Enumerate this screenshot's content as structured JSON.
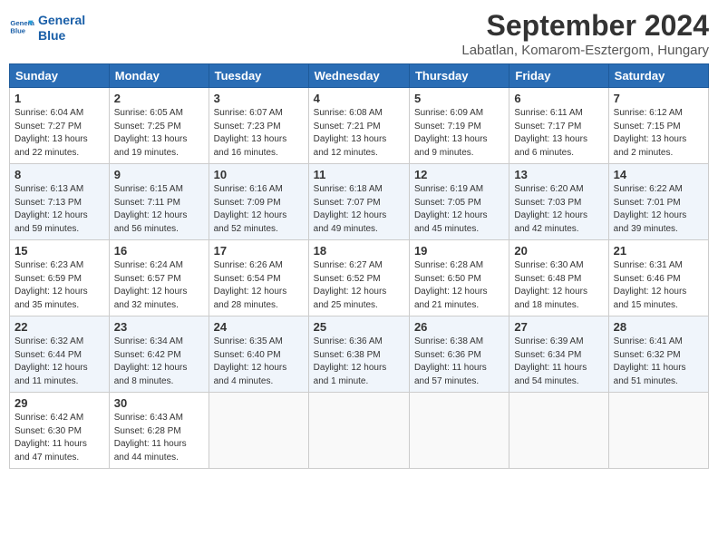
{
  "header": {
    "logo_line1": "General",
    "logo_line2": "Blue",
    "title": "September 2024",
    "location": "Labatlan, Komarom-Esztergom, Hungary"
  },
  "weekdays": [
    "Sunday",
    "Monday",
    "Tuesday",
    "Wednesday",
    "Thursday",
    "Friday",
    "Saturday"
  ],
  "weeks": [
    [
      {
        "day": "1",
        "details": "Sunrise: 6:04 AM\nSunset: 7:27 PM\nDaylight: 13 hours\nand 22 minutes."
      },
      {
        "day": "2",
        "details": "Sunrise: 6:05 AM\nSunset: 7:25 PM\nDaylight: 13 hours\nand 19 minutes."
      },
      {
        "day": "3",
        "details": "Sunrise: 6:07 AM\nSunset: 7:23 PM\nDaylight: 13 hours\nand 16 minutes."
      },
      {
        "day": "4",
        "details": "Sunrise: 6:08 AM\nSunset: 7:21 PM\nDaylight: 13 hours\nand 12 minutes."
      },
      {
        "day": "5",
        "details": "Sunrise: 6:09 AM\nSunset: 7:19 PM\nDaylight: 13 hours\nand 9 minutes."
      },
      {
        "day": "6",
        "details": "Sunrise: 6:11 AM\nSunset: 7:17 PM\nDaylight: 13 hours\nand 6 minutes."
      },
      {
        "day": "7",
        "details": "Sunrise: 6:12 AM\nSunset: 7:15 PM\nDaylight: 13 hours\nand 2 minutes."
      }
    ],
    [
      {
        "day": "8",
        "details": "Sunrise: 6:13 AM\nSunset: 7:13 PM\nDaylight: 12 hours\nand 59 minutes."
      },
      {
        "day": "9",
        "details": "Sunrise: 6:15 AM\nSunset: 7:11 PM\nDaylight: 12 hours\nand 56 minutes."
      },
      {
        "day": "10",
        "details": "Sunrise: 6:16 AM\nSunset: 7:09 PM\nDaylight: 12 hours\nand 52 minutes."
      },
      {
        "day": "11",
        "details": "Sunrise: 6:18 AM\nSunset: 7:07 PM\nDaylight: 12 hours\nand 49 minutes."
      },
      {
        "day": "12",
        "details": "Sunrise: 6:19 AM\nSunset: 7:05 PM\nDaylight: 12 hours\nand 45 minutes."
      },
      {
        "day": "13",
        "details": "Sunrise: 6:20 AM\nSunset: 7:03 PM\nDaylight: 12 hours\nand 42 minutes."
      },
      {
        "day": "14",
        "details": "Sunrise: 6:22 AM\nSunset: 7:01 PM\nDaylight: 12 hours\nand 39 minutes."
      }
    ],
    [
      {
        "day": "15",
        "details": "Sunrise: 6:23 AM\nSunset: 6:59 PM\nDaylight: 12 hours\nand 35 minutes."
      },
      {
        "day": "16",
        "details": "Sunrise: 6:24 AM\nSunset: 6:57 PM\nDaylight: 12 hours\nand 32 minutes."
      },
      {
        "day": "17",
        "details": "Sunrise: 6:26 AM\nSunset: 6:54 PM\nDaylight: 12 hours\nand 28 minutes."
      },
      {
        "day": "18",
        "details": "Sunrise: 6:27 AM\nSunset: 6:52 PM\nDaylight: 12 hours\nand 25 minutes."
      },
      {
        "day": "19",
        "details": "Sunrise: 6:28 AM\nSunset: 6:50 PM\nDaylight: 12 hours\nand 21 minutes."
      },
      {
        "day": "20",
        "details": "Sunrise: 6:30 AM\nSunset: 6:48 PM\nDaylight: 12 hours\nand 18 minutes."
      },
      {
        "day": "21",
        "details": "Sunrise: 6:31 AM\nSunset: 6:46 PM\nDaylight: 12 hours\nand 15 minutes."
      }
    ],
    [
      {
        "day": "22",
        "details": "Sunrise: 6:32 AM\nSunset: 6:44 PM\nDaylight: 12 hours\nand 11 minutes."
      },
      {
        "day": "23",
        "details": "Sunrise: 6:34 AM\nSunset: 6:42 PM\nDaylight: 12 hours\nand 8 minutes."
      },
      {
        "day": "24",
        "details": "Sunrise: 6:35 AM\nSunset: 6:40 PM\nDaylight: 12 hours\nand 4 minutes."
      },
      {
        "day": "25",
        "details": "Sunrise: 6:36 AM\nSunset: 6:38 PM\nDaylight: 12 hours\nand 1 minute."
      },
      {
        "day": "26",
        "details": "Sunrise: 6:38 AM\nSunset: 6:36 PM\nDaylight: 11 hours\nand 57 minutes."
      },
      {
        "day": "27",
        "details": "Sunrise: 6:39 AM\nSunset: 6:34 PM\nDaylight: 11 hours\nand 54 minutes."
      },
      {
        "day": "28",
        "details": "Sunrise: 6:41 AM\nSunset: 6:32 PM\nDaylight: 11 hours\nand 51 minutes."
      }
    ],
    [
      {
        "day": "29",
        "details": "Sunrise: 6:42 AM\nSunset: 6:30 PM\nDaylight: 11 hours\nand 47 minutes."
      },
      {
        "day": "30",
        "details": "Sunrise: 6:43 AM\nSunset: 6:28 PM\nDaylight: 11 hours\nand 44 minutes."
      },
      {
        "day": "",
        "details": ""
      },
      {
        "day": "",
        "details": ""
      },
      {
        "day": "",
        "details": ""
      },
      {
        "day": "",
        "details": ""
      },
      {
        "day": "",
        "details": ""
      }
    ]
  ]
}
